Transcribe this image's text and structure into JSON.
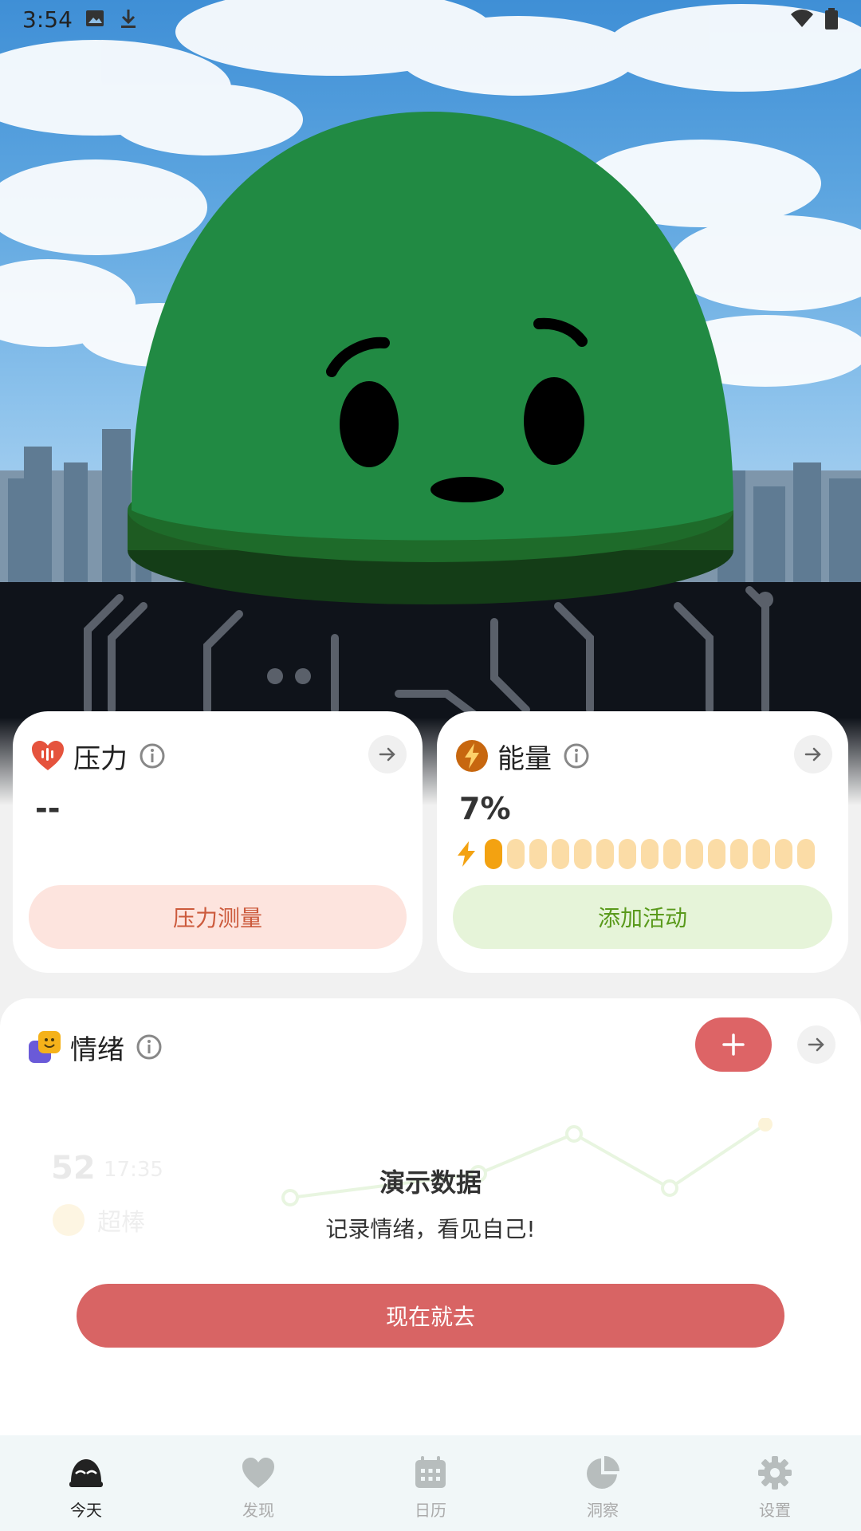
{
  "status_bar": {
    "time": "3:54"
  },
  "stress_card": {
    "title": "压力",
    "value": "--",
    "button_label": "压力测量",
    "accent": "#e5533d"
  },
  "energy_card": {
    "title": "能量",
    "value": "7%",
    "level_fraction": 0.07,
    "segments_total": 15,
    "segments_filled": 1,
    "button_label": "添加活动",
    "accent": "#f3a211"
  },
  "mood_card": {
    "title": "情绪",
    "demo_title": "演示数据",
    "demo_subtitle": "记录情绪，看见自己!",
    "cta_label": "现在就去",
    "ghost_value": "52",
    "ghost_time": "17:35",
    "ghost_label": "超棒",
    "accent": "#dd6466"
  },
  "bottom_nav": {
    "items": [
      {
        "label": "今天",
        "icon": "today-icon",
        "active": true
      },
      {
        "label": "发现",
        "icon": "heart-icon",
        "active": false
      },
      {
        "label": "日历",
        "icon": "calendar-icon",
        "active": false
      },
      {
        "label": "洞察",
        "icon": "pie-chart-icon",
        "active": false
      },
      {
        "label": "设置",
        "icon": "gear-icon",
        "active": false
      }
    ]
  }
}
